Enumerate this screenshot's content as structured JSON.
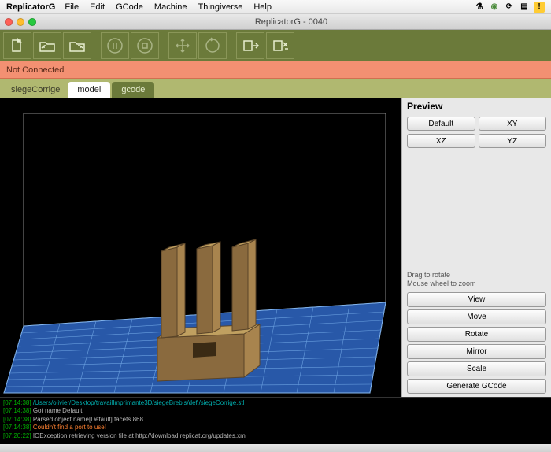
{
  "mac_menu": {
    "app": "ReplicatorG",
    "items": [
      "File",
      "Edit",
      "GCode",
      "Machine",
      "Thingiverse",
      "Help"
    ]
  },
  "window": {
    "title": "ReplicatorG - 0040"
  },
  "status": {
    "text": "Not Connected"
  },
  "tabs": {
    "file": "siegeCorrige",
    "model": "model",
    "gcode": "gcode"
  },
  "sidebar": {
    "title": "Preview",
    "view_buttons": {
      "default": "Default",
      "xy": "XY",
      "xz": "XZ",
      "yz": "YZ"
    },
    "hint1": "Drag to rotate",
    "hint2": "Mouse wheel to zoom",
    "actions": {
      "view": "View",
      "move": "Move",
      "rotate": "Rotate",
      "mirror": "Mirror",
      "scale": "Scale",
      "generate": "Generate GCode"
    }
  },
  "console": {
    "lines": [
      {
        "ts": "[07:14:38]",
        "cls": "path",
        "text": "/Users/olivier/Desktop/travailImprimante3D/siegeBrebis/defi/siegeCorrige.stl"
      },
      {
        "ts": "[07:14:38]",
        "cls": "info",
        "text": "Got name Default"
      },
      {
        "ts": "[07:14:38]",
        "cls": "info",
        "text": "Parsed object name[Default] facets 868"
      },
      {
        "ts": "[07:14:38]",
        "cls": "error",
        "text": "Couldn't find a port to use!"
      },
      {
        "ts": "[07:20:22]",
        "cls": "info",
        "text": "IOException retrieving version file at http://download.replicat.org/updates.xml"
      }
    ]
  }
}
